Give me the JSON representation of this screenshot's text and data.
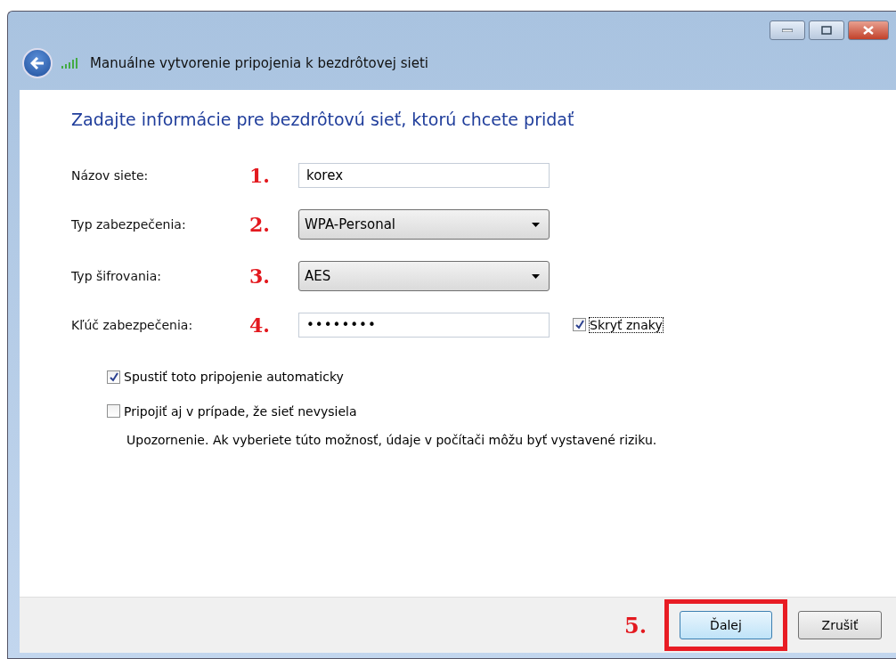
{
  "window": {
    "title": "Manuálne vytvorenie pripojenia k bezdrôtovej sieti"
  },
  "heading": "Zadajte informácie pre bezdrôtovú sieť, ktorú chcete pridať",
  "fields": [
    {
      "label": "Názov siete:",
      "marker": "1.",
      "kind": "text",
      "value": "korex"
    },
    {
      "label": "Typ zabezpečenia:",
      "marker": "2.",
      "kind": "dropdown",
      "value": "WPA-Personal"
    },
    {
      "label": "Typ šifrovania:",
      "marker": "3.",
      "kind": "dropdown",
      "value": "AES"
    },
    {
      "label": "Kľúč zabezpečenia:",
      "marker": "4.",
      "kind": "password",
      "value": "••••••••",
      "option": {
        "label": "Skryť znaky",
        "checked": true
      }
    }
  ],
  "options": [
    {
      "label": "Spustiť toto pripojenie automaticky",
      "checked": true
    },
    {
      "label": "Pripojiť aj v prípade, že sieť nevysiela",
      "checked": false,
      "note": "Upozornenie. Ak vyberiete túto možnosť, údaje v počítači môžu byť vystavené riziku."
    }
  ],
  "footer": {
    "marker": "5.",
    "buttons": [
      {
        "label": "Ďalej",
        "default": true,
        "highlighted": true
      },
      {
        "label": "Zrušiť",
        "default": false,
        "highlighted": false
      }
    ]
  }
}
